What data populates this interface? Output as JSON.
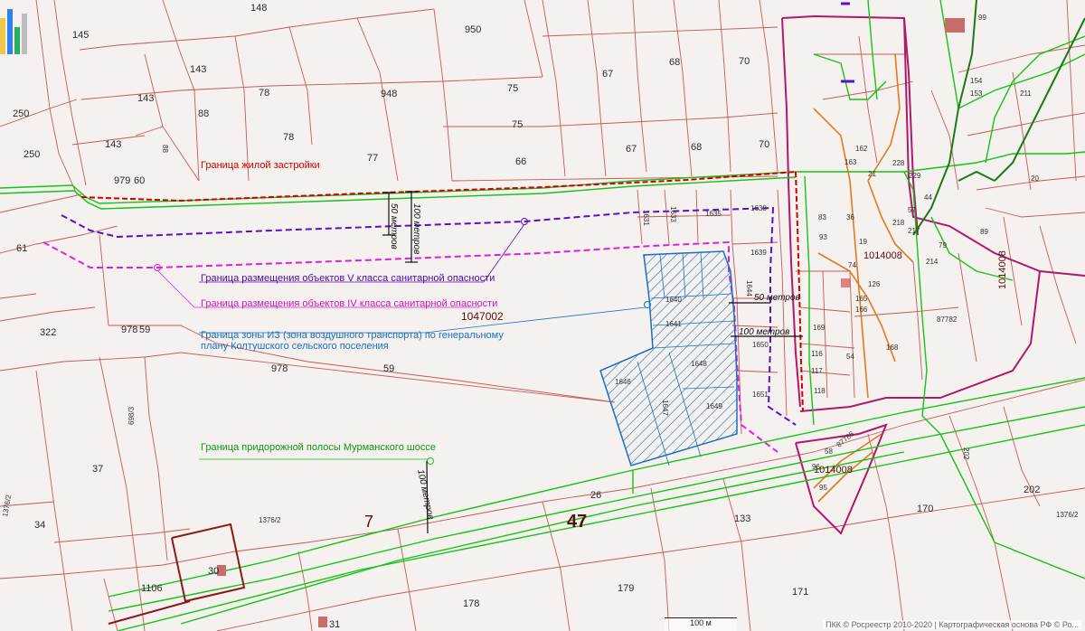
{
  "labels": {
    "residential_boundary": "Граница жилой застройки",
    "zone_v": "Граница размещения объектов V класса санитарной опасности",
    "zone_iv": "Граница размещения объектов IV класса санитарной опасности",
    "zone_iz_1": "Граница зоны ИЗ (зона воздушного транспорта) по генеральному",
    "zone_iz_2": "плану Колтушского сельского поселения",
    "roadside": "Граница придорожной полосы Мурманского шоссе"
  },
  "dimensions": {
    "d50_v": "50 метров",
    "d100_v": "100 метров",
    "d50_h": "50 метров",
    "d100_h": "100 метров",
    "d100_road": "100 метров"
  },
  "quarters": {
    "q1047002": "1047002",
    "q1014008_a": "1014008",
    "q1014008_b": "1014008",
    "q1014008_c": "1014008",
    "road7": "7",
    "road47": "47"
  },
  "parcels": {
    "p148": "148",
    "p950": "950",
    "p145": "145",
    "p143a": "143",
    "p143b": "143",
    "p143c": "143",
    "p250a": "250",
    "p250b": "250",
    "p78a": "78",
    "p78b": "78",
    "p948": "948",
    "p88a": "88",
    "p88b": "88",
    "p75a": "75",
    "p75b": "75",
    "p67a": "67",
    "p67b": "67",
    "p68a": "68",
    "p68b": "68",
    "p70a": "70",
    "p70b": "70",
    "p77a": "77",
    "p66": "66",
    "p979": "979",
    "p60": "60",
    "p61": "61",
    "p322": "322",
    "p978a": "978",
    "p59a": "59",
    "p978b": "978",
    "p59b": "59",
    "p6983": "698/3",
    "p37": "37",
    "p13762a": "1376/2",
    "p34": "34",
    "p13762b": "1376/2",
    "p30": "30",
    "p1106": "1106",
    "p31": "31",
    "p178": "178",
    "p179": "179",
    "p171": "171",
    "p133": "133",
    "p26": "26",
    "p170": "170",
    "p202a": "202",
    "p202b": "202",
    "p13762c": "1376/2",
    "p1631": "1631",
    "p1633": "1633",
    "p1635": "1635",
    "p1638": "1638",
    "p1639": "1639",
    "p1644": "1644",
    "p1650": "1650",
    "p1651": "1651",
    "p1640": "1640",
    "p1641": "1641",
    "p1648": "1648",
    "p1646": "1646",
    "p1647": "1647",
    "p1649": "1649",
    "p169": "169",
    "p116": "116",
    "p117": "117",
    "p118": "118",
    "p54": "54",
    "p168": "168",
    "p165": "165",
    "p166": "166",
    "p74": "74",
    "p126": "126",
    "p87782": "87782",
    "p214": "214",
    "p79": "79",
    "p89": "89",
    "p218": "218",
    "p217": "217",
    "p57": "57",
    "p44": "44",
    "p229": "229",
    "p228": "228",
    "p162": "162",
    "p163": "163",
    "p21": "21",
    "p36": "36",
    "p83": "83",
    "p93": "93",
    "p19": "19",
    "p99": "99",
    "p154": "154",
    "p153": "153",
    "p211": "211",
    "p20": "20",
    "p58": "58",
    "p96": "96",
    "p95": "95",
    "p87786": "87786"
  },
  "footer": {
    "scale": "100 м",
    "attribution": "ПКК © Росреестр 2010-2020 | Картографическая основа РФ © Ро..."
  },
  "colors": {
    "background": "#f4f1ee",
    "parcel": "#c45a5a",
    "residential_boundary": "#d40000",
    "zone_v": "#5a10c8",
    "zone_iv": "#e020d8",
    "zone_iz": "#1a6fc2",
    "roadside": "#17c217",
    "road_bold": "#8a1a1a"
  }
}
